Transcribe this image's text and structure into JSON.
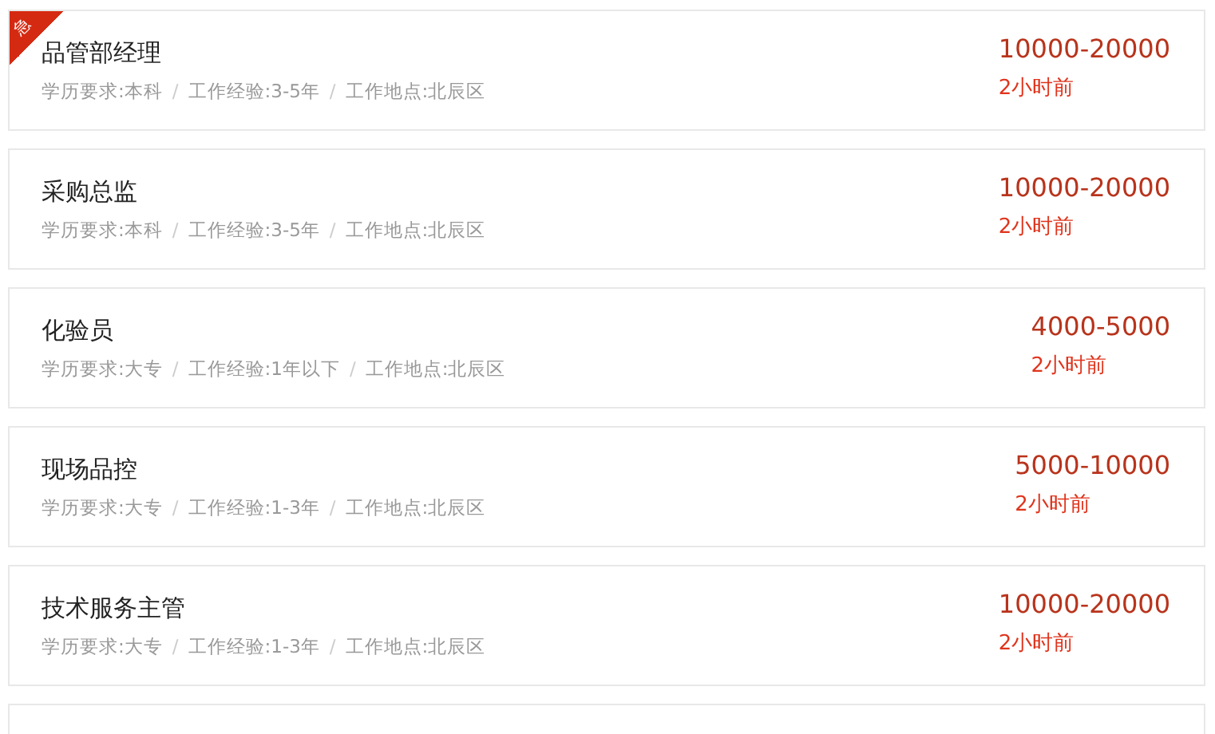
{
  "jobs": [
    {
      "title": "品管部经理",
      "urgent": true,
      "badge": "急",
      "meta": [
        {
          "kind": "item",
          "text": "学历要求:本科"
        },
        {
          "kind": "separator",
          "text": "/"
        },
        {
          "kind": "item",
          "text": "工作经验:3-5年"
        },
        {
          "kind": "separator",
          "text": "/"
        },
        {
          "kind": "item",
          "text": "工作地点:北辰区"
        }
      ],
      "salary": "10000-20000",
      "posted": "2小时前"
    },
    {
      "title": "采购总监",
      "urgent": false,
      "meta": [
        {
          "kind": "item",
          "text": "学历要求:本科"
        },
        {
          "kind": "separator",
          "text": "/"
        },
        {
          "kind": "item",
          "text": "工作经验:3-5年"
        },
        {
          "kind": "separator",
          "text": "/"
        },
        {
          "kind": "item",
          "text": "工作地点:北辰区"
        }
      ],
      "salary": "10000-20000",
      "posted": "2小时前"
    },
    {
      "title": "化验员",
      "urgent": false,
      "meta": [
        {
          "kind": "item",
          "text": "学历要求:大专"
        },
        {
          "kind": "separator",
          "text": "/"
        },
        {
          "kind": "item",
          "text": "工作经验:1年以下"
        },
        {
          "kind": "separator",
          "text": "/"
        },
        {
          "kind": "item",
          "text": "工作地点:北辰区"
        }
      ],
      "salary": "4000-5000",
      "posted": "2小时前"
    },
    {
      "title": "现场品控",
      "urgent": false,
      "meta": [
        {
          "kind": "item",
          "text": "学历要求:大专"
        },
        {
          "kind": "separator",
          "text": "/"
        },
        {
          "kind": "item",
          "text": "工作经验:1-3年"
        },
        {
          "kind": "separator",
          "text": "/"
        },
        {
          "kind": "item",
          "text": "工作地点:北辰区"
        }
      ],
      "salary": "5000-10000",
      "posted": "2小时前"
    },
    {
      "title": "技术服务主管",
      "urgent": false,
      "meta": [
        {
          "kind": "item",
          "text": "学历要求:大专"
        },
        {
          "kind": "separator",
          "text": "/"
        },
        {
          "kind": "item",
          "text": "工作经验:1-3年"
        },
        {
          "kind": "separator",
          "text": "/"
        },
        {
          "kind": "item",
          "text": "工作地点:北辰区"
        }
      ],
      "salary": "10000-20000",
      "posted": "2小时前"
    }
  ]
}
